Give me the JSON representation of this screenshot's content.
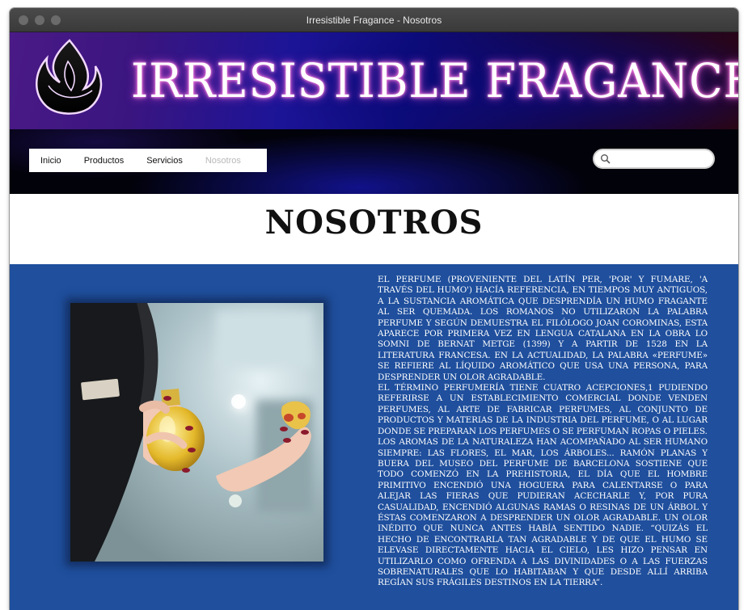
{
  "window": {
    "title": "Irresistible Fragance - Nosotros"
  },
  "brand": {
    "name": "IRRESISTIBLE FRAGANCE"
  },
  "nav": {
    "items": [
      {
        "label": "Inicio"
      },
      {
        "label": "Productos"
      },
      {
        "label": "Servicios"
      },
      {
        "label": "Nosotros"
      }
    ],
    "active": "Nosotros"
  },
  "search": {
    "value": "",
    "placeholder": ""
  },
  "page": {
    "title": "NOSOTROS"
  },
  "content": {
    "paragraphs": [
      "El perfume (proveniente del latín per, 'por' y fumare, 'a través del humo') hacía referencia, en tiempos muy antiguos, a la sustancia aromática que desprendía un humo fragante al ser quemada. Los romanos no utilizaron la palabra perfume y según demuestra el filólogo Joan Corominas, esta aparece por primera vez en lengua catalana en la obra Lo somni de Bernat Metge (1399) y a partir de 1528 en la literatura francesa. En la actualidad, la palabra «perfume» se refiere al líquido aromático que usa una persona, para desprender un olor agradable.",
      "El término perfumería tiene cuatro acepciones,1 pudiendo referirse a un establecimiento comercial donde venden perfumes, al arte de fabricar perfumes, al conjunto de productos y materias de la industria del perfume, o al lugar donde se preparan los perfumes o se perfuman ropas o pieles.",
      "Los aromas de la naturaleza han acompañado al ser humano siempre: las flores, el mar, los árboles... Ramón Planas y Buera del Museo del Perfume de Barcelona sostiene que todo comenzó en la Prehistoria, el día que el hombre primitivo encendió una hoguera para calentarse o para alejar las fieras que pudieran acecharle y, por pura casualidad, encendió algunas ramas o resinas de un árbol y éstas comenzaron a desprender un olor agradable. Un olor inédito que nunca antes había sentido nadie. “Quizás el hecho de encontrarla tan agradable y de que el humo se elevase directamente hacia el cielo, les hizo pensar en utilizarlo como ofrenda a las divinidades o a las fuerzas sobrenaturales que lo habitaban y que desde allí arriba regían sus frágiles destinos en la Tierra”."
    ]
  },
  "colors": {
    "content_bg": "#1f4f9d",
    "banner_purple": "#4a1a86",
    "banner_blue": "#1c1497",
    "brand_glow": "#ff7adf",
    "nav_active": "#b8b8b8"
  },
  "icons": [
    "flame-logo-icon",
    "search-icon"
  ]
}
